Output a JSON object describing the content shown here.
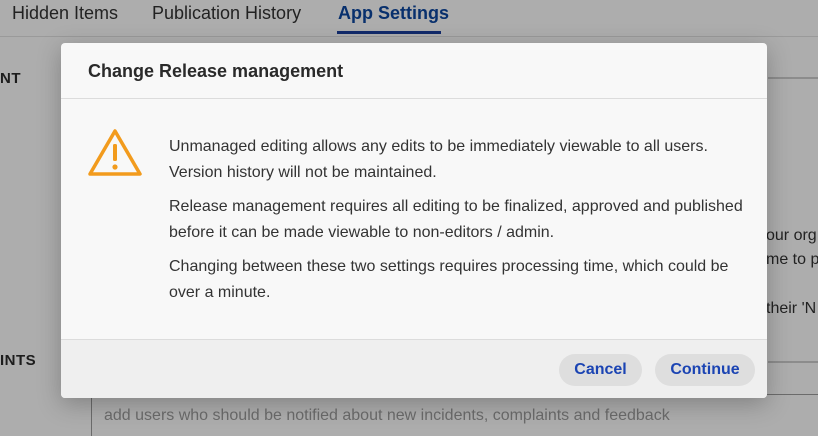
{
  "background": {
    "tabs": [
      {
        "label": "Hidden Items"
      },
      {
        "label": "Publication History"
      },
      {
        "label": "App Settings",
        "active": true
      }
    ],
    "section_label_1": "NT",
    "section_label_2": "INTS",
    "right_snippets": [
      "our org",
      "me to p",
      "their 'N"
    ],
    "notify_placeholder": "add users who should be notified about new incidents, complaints and feedback"
  },
  "dialog": {
    "title": "Change Release management",
    "icon": "warning-triangle-icon",
    "paragraphs": [
      "Unmanaged editing allows any edits to be immediately viewable to all users. Version history will not be maintained.",
      "Release management requires all editing to be finalized, approved and published before it can be made viewable to non-editors / admin.",
      "Changing between these two settings requires processing time, which could be over a minute."
    ],
    "cancel_label": "Cancel",
    "continue_label": "Continue"
  },
  "colors": {
    "accent": "#1b44b3",
    "warning": "#f29b1d",
    "active_tab": "#0d47a1"
  }
}
